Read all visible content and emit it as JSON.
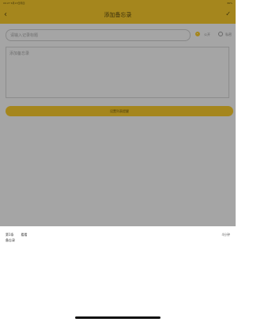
{
  "status_bar": {
    "time": "09:27",
    "date": "6月13日周四",
    "right": "86%"
  },
  "navbar": {
    "back_icon": "‹",
    "title": "添加备忘录",
    "confirm_icon": "✓"
  },
  "form": {
    "title_placeholder": "请输入记录标题",
    "options": [
      {
        "label": "公开",
        "selected": true
      },
      {
        "label": "私密",
        "selected": false
      }
    ],
    "content_placeholder": "添加备忘录",
    "submit_label": "设置列表提醒"
  },
  "sheet": {
    "item_index": "第1条",
    "item_title": "看看",
    "item_time": "4分钟",
    "item_subtitle": "备忘录"
  },
  "colors": {
    "accent": "#f3c62b",
    "overlay": "rgba(0,0,0,0.32)"
  }
}
